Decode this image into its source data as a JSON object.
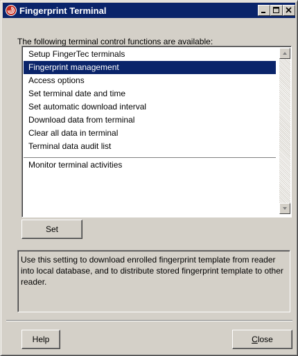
{
  "window": {
    "title": "Fingerprint Terminal",
    "icon": "fingerprint-app-icon",
    "controls": [
      "minimize-icon",
      "maximize-icon",
      "close-icon"
    ]
  },
  "caption": "The following terminal control functions are available:",
  "functions": {
    "items": [
      "Setup FingerTec terminals",
      "Fingerprint management",
      "Access options",
      "Set terminal date and time",
      "Set automatic download interval",
      "Download data from terminal",
      "Clear all data in terminal",
      "Terminal data audit list",
      "Monitor terminal activities"
    ],
    "selected": "Fingerprint management"
  },
  "buttons": {
    "set": "Set",
    "help": "Help",
    "close_prefix": "C",
    "close_rest": "lose"
  },
  "description": "Use this setting to download enrolled fingerprint template from reader into local database, and to distribute stored fingerprint template to other reader.",
  "colors": {
    "titlebar": "#0a246a",
    "selection": "#0a246a",
    "face": "#d4d0c8",
    "icon_red": "#c0281e"
  }
}
